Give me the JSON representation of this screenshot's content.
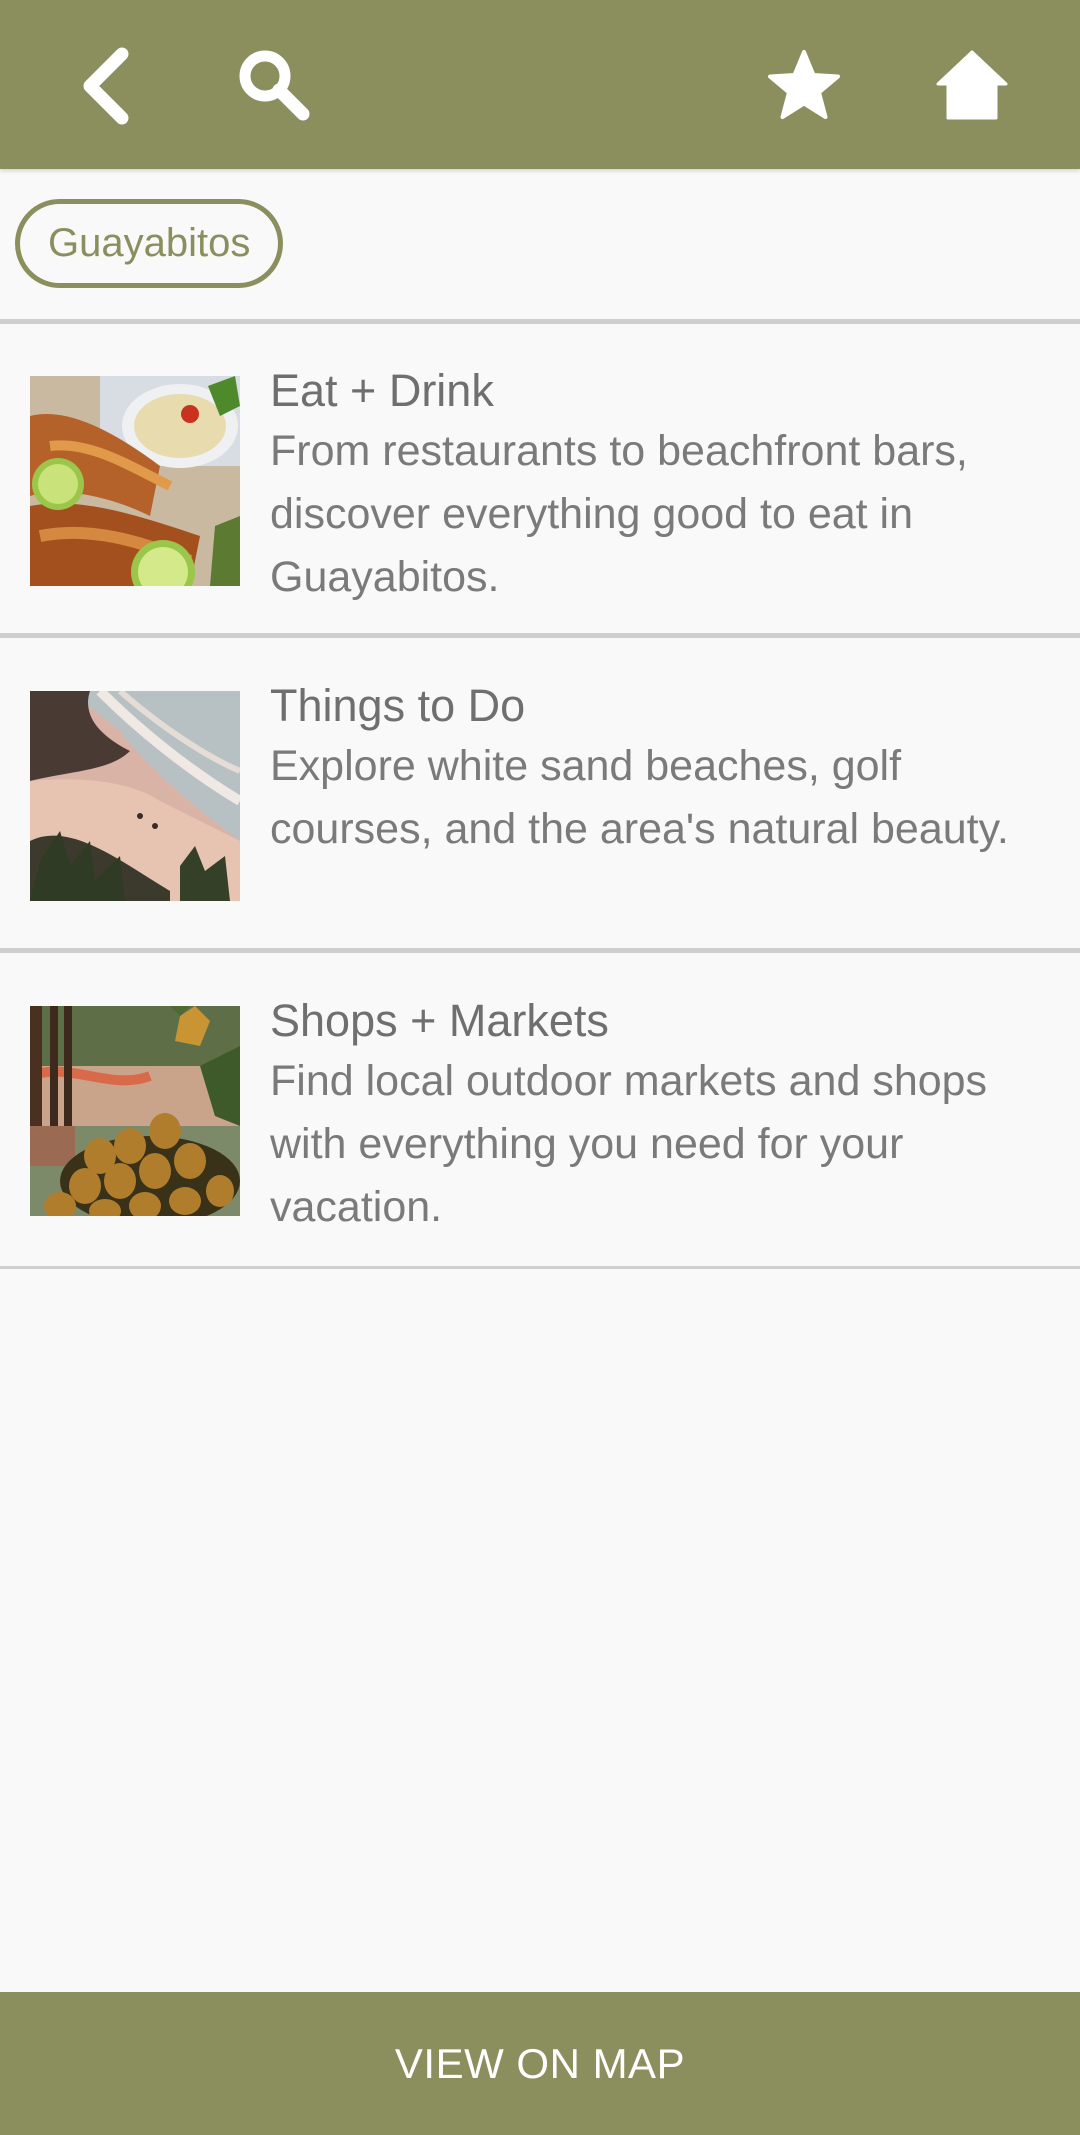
{
  "header": {
    "icons": [
      "back-icon",
      "search-icon",
      "star-icon",
      "home-icon"
    ],
    "background_color": "#8b8f5e"
  },
  "location_chip": {
    "label": "Guayabitos"
  },
  "categories": [
    {
      "title": "Eat + Drink",
      "description": "From restaurants to beachfront bars, discover everything good to eat in Guayabitos.",
      "thumbnail": "food-photo"
    },
    {
      "title": "Things to Do",
      "description": "Explore white sand beaches, golf courses, and the area's natural beauty.",
      "thumbnail": "beach-photo"
    },
    {
      "title": "Shops + Markets",
      "description": "Find local outdoor markets and shops with everything you need for your vacation.",
      "thumbnail": "pineapple-market-photo"
    }
  ],
  "footer": {
    "map_button_label": "VIEW ON MAP"
  }
}
